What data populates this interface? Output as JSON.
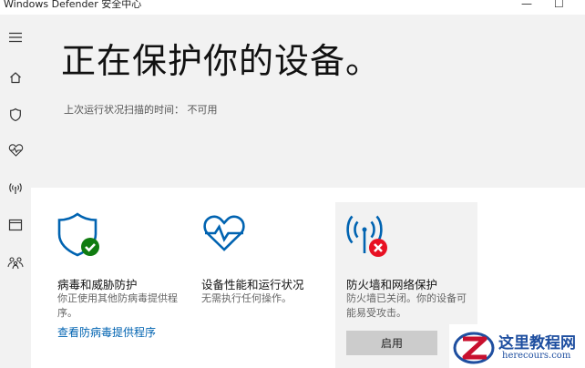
{
  "window": {
    "title": "Windows Defender 安全中心",
    "min_glyph": "—",
    "max_glyph": "☐"
  },
  "sidebar": {
    "items": [
      {
        "icon": "hamburger-menu-icon"
      },
      {
        "icon": "home-icon"
      },
      {
        "icon": "shield-icon"
      },
      {
        "icon": "heart-pulse-icon"
      },
      {
        "icon": "wireless-antenna-icon"
      },
      {
        "icon": "browser-window-icon"
      },
      {
        "icon": "family-people-icon"
      }
    ]
  },
  "hero": {
    "heading": "正在保护你的设备。",
    "last_scan": "上次运行状况扫描的时间：  不可用"
  },
  "tiles": {
    "virus": {
      "title": "病毒和威胁防护",
      "desc": "你正使用其他防病毒提供程序。",
      "link": "查看防病毒提供程序",
      "status": "ok"
    },
    "performance": {
      "title": "设备性能和运行状况",
      "desc": "无需执行任何操作。"
    },
    "firewall": {
      "title": "防火墙和网络保护",
      "desc": "防火墙已关闭。你的设备可能易受攻击。",
      "button": "启用",
      "status": "error"
    }
  },
  "colors": {
    "accent": "#0063b1",
    "ok": "#107c10",
    "error": "#e81123",
    "panel": "#f2f2f2"
  },
  "watermark": {
    "name": "这里教程网",
    "url": "herecours.com"
  }
}
